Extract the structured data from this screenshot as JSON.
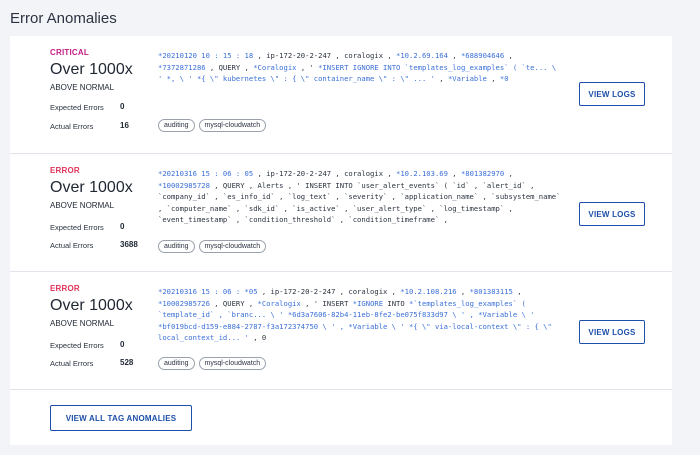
{
  "page_title": "Error Anomalies",
  "labels": {
    "expected_errors": "Expected Errors",
    "actual_errors": "Actual Errors",
    "view_logs": "VIEW LOGS"
  },
  "anomalies": [
    {
      "severity": "CRITICAL",
      "headline": "Over 1000x",
      "sub": "ABOVE NORMAL",
      "expected": "0",
      "actual": "16",
      "log": [
        {
          "t": "*20210120 10 : 15 : 18",
          "h": true
        },
        {
          "t": " , ip-172-20-2-247 , coralogix , ",
          "h": false
        },
        {
          "t": "*10.2.69.164",
          "h": true
        },
        {
          "t": " , ",
          "h": false
        },
        {
          "t": "*688904646",
          "h": true
        },
        {
          "t": " , ",
          "h": false
        },
        {
          "t": "*7372871286",
          "h": true
        },
        {
          "t": " , QUERY , ",
          "h": false
        },
        {
          "t": "*Coralogix",
          "h": true
        },
        {
          "t": " , ' ",
          "h": false
        },
        {
          "t": "*INSERT IGNORE INTO `templates_log_examples` ( `te... \\ ' *, \\ ' *{ \\\" kubernetes \\\" : { \\\" container_name \\\" : \\\" ... '",
          "h": true
        },
        {
          "t": " , ",
          "h": false
        },
        {
          "t": "*Variable",
          "h": true
        },
        {
          "t": " , ",
          "h": false
        },
        {
          "t": "*0",
          "h": true
        }
      ],
      "tags": [
        "auditing",
        "mysql-cloudwatch"
      ]
    },
    {
      "severity": "ERROR",
      "headline": "Over 1000x",
      "sub": "ABOVE NORMAL",
      "expected": "0",
      "actual": "3688",
      "log": [
        {
          "t": "*20210316 15 : 06 : 05",
          "h": true
        },
        {
          "t": " , ip-172-20-2-247 , coralogix , ",
          "h": false
        },
        {
          "t": "*10.2.103.69",
          "h": true
        },
        {
          "t": " , ",
          "h": false
        },
        {
          "t": "*801382970",
          "h": true
        },
        {
          "t": " , ",
          "h": false
        },
        {
          "t": "*10002985728",
          "h": true
        },
        {
          "t": " , QUERY , Alerts , ' INSERT INTO `user_alert_events` ( `id` , `alert_id` , `company_id` , `es_info_id` , `log_text` , `severity` , `application_name` , `subsystem_name` , `computer_name` , `sdk_id` , `is_active` , `user_alert_type` , `log_timestamp` , `event_timestamp` , `condition_threshold` , `condition_timeframe` ,",
          "h": false
        }
      ],
      "tags": [
        "auditing",
        "mysql-cloudwatch"
      ]
    },
    {
      "severity": "ERROR",
      "headline": "Over 1000x",
      "sub": "ABOVE NORMAL",
      "expected": "0",
      "actual": "528",
      "log": [
        {
          "t": "*20210316 15 : 06 : *05",
          "h": true
        },
        {
          "t": " , ip-172-20-2-247 , coralogix , ",
          "h": false
        },
        {
          "t": "*10.2.108.216",
          "h": true
        },
        {
          "t": " , ",
          "h": false
        },
        {
          "t": "*801383115",
          "h": true
        },
        {
          "t": " , ",
          "h": false
        },
        {
          "t": "*10002985726",
          "h": true
        },
        {
          "t": " , QUERY , ",
          "h": false
        },
        {
          "t": "*Coralogix",
          "h": true
        },
        {
          "t": " , ' INSERT ",
          "h": false
        },
        {
          "t": "*IGNORE",
          "h": true
        },
        {
          "t": " INTO ",
          "h": false
        },
        {
          "t": "*`templates_log_examples` ( `template_id` , `branc... \\ ' *6d3a7606-82b4-11eb-8fe2-be075f833d97 \\ ' , *Variable \\ ' *bf019bcd-d159-e884-2787-f3a172374750 \\ ' , *Variable \\ ' *{ \\\" via-local-context \\\" : { \\\" local_context_id... '",
          "h": true
        },
        {
          "t": " , 0",
          "h": false
        }
      ],
      "tags": [
        "auditing",
        "mysql-cloudwatch"
      ]
    }
  ],
  "footer": {
    "view_all_label": "VIEW ALL TAG ANOMALIES"
  },
  "colors": {
    "critical": "#c41d83",
    "error": "#e0335a",
    "accent": "#1d4fa8",
    "log_highlight": "#3a6fd8"
  }
}
